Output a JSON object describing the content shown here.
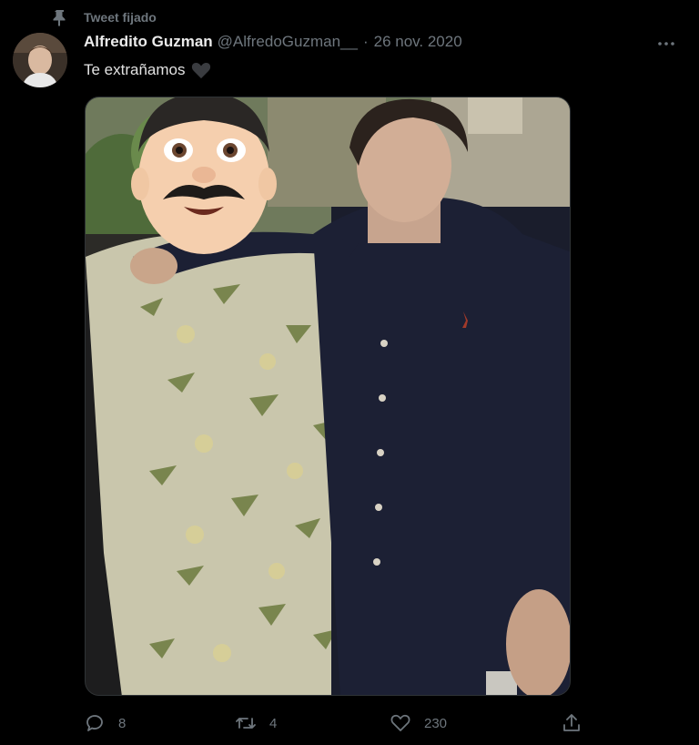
{
  "pinned": {
    "label": "Tweet fijado",
    "icon": "pin-icon"
  },
  "tweet": {
    "author_name": "Alfredito Guzman",
    "handle": "@AlfredoGuzman__",
    "separator": "·",
    "date": "26 nov. 2020",
    "text": "Te extrañamos",
    "text_emoji": "black-heart-icon",
    "media_description_icon": "photo"
  },
  "actions": {
    "reply": {
      "icon": "reply-icon",
      "count": "8"
    },
    "retweet": {
      "icon": "retweet-icon",
      "count": "4"
    },
    "like": {
      "icon": "heart-icon",
      "count": "230"
    },
    "share": {
      "icon": "share-icon"
    }
  },
  "colors": {
    "background": "#000000",
    "secondary_text": "#6e767d",
    "primary_text": "#e2e2e2"
  }
}
